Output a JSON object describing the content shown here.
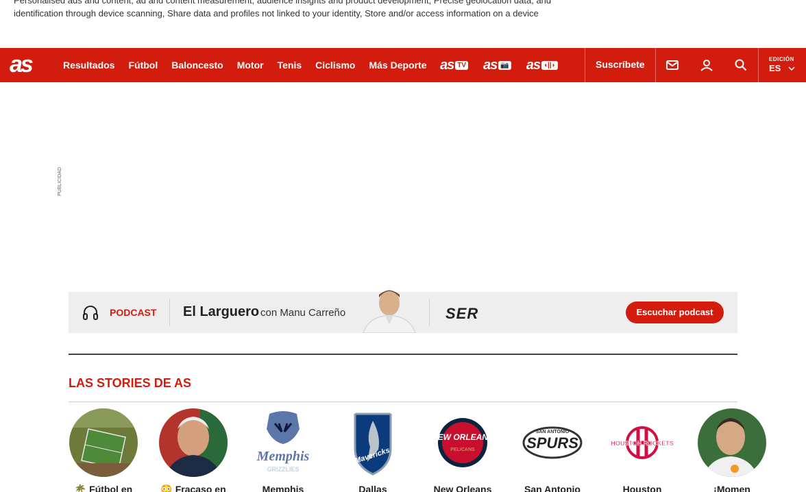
{
  "consent": {
    "text": "Personalised ads and content, ad and content measurement, audience insights and product development, Precise geolocation data, and identification through device scanning, Share data and profiles not linked to your identity, Store and/or access information on a device"
  },
  "nav": {
    "logo": "as",
    "links": [
      "Resultados",
      "Fútbol",
      "Baloncesto",
      "Motor",
      "Tenis",
      "Ciclismo",
      "Más Deporte"
    ],
    "brands": [
      {
        "name": "as",
        "badge": "TV"
      },
      {
        "name": "as",
        "badge": "📷"
      },
      {
        "name": "as",
        "badge": "◖||◗"
      }
    ],
    "subscribe": "Suscríbete",
    "icons": [
      "mail-icon",
      "user-icon",
      "search-icon"
    ],
    "edition_label": "EDICIÓN",
    "edition_value": "ES"
  },
  "ad": {
    "label": "PUBLICIDAD"
  },
  "podcast": {
    "tag": "PODCAST",
    "title": "El Larguero",
    "host": "con Manu Carreño",
    "network": "SER",
    "button": "Escuchar podcast"
  },
  "stories": {
    "title": "LAS STORIES DE AS",
    "items": [
      {
        "label": "🌴 Fútbol en"
      },
      {
        "label": "😳 Fracaso en"
      },
      {
        "label": "Memphis"
      },
      {
        "label": "Dallas"
      },
      {
        "label": "New Orleans"
      },
      {
        "label": "San Antonio"
      },
      {
        "label": "Houston"
      },
      {
        "label": "¡Momen"
      }
    ]
  },
  "colors": {
    "brand": "#d21d0e",
    "podcast_bg": "#eeeeee"
  }
}
